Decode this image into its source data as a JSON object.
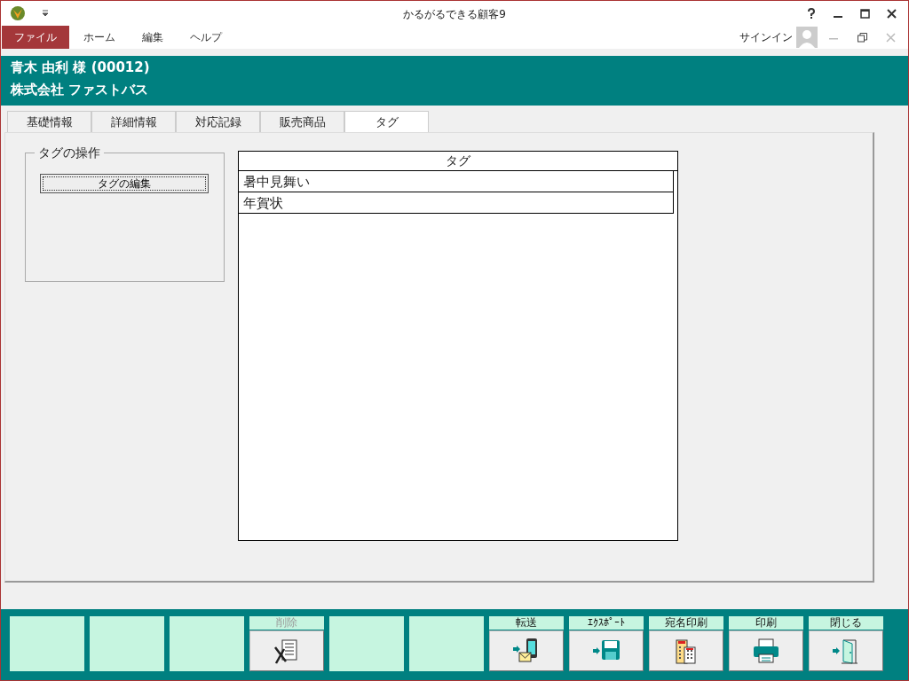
{
  "window": {
    "title": "かるがるできる顧客9"
  },
  "menu": [
    {
      "label": "ファイル",
      "selected": true
    },
    {
      "label": "ホーム",
      "selected": false
    },
    {
      "label": "編集",
      "selected": false
    },
    {
      "label": "ヘルプ",
      "selected": false
    }
  ],
  "account": {
    "label": "サインイン"
  },
  "customer": {
    "name": "青木  由利 様 (00012)",
    "company": "株式会社  ファストバス"
  },
  "tabs": [
    {
      "label": "基礎情報",
      "selected": false
    },
    {
      "label": "詳細情報",
      "selected": false
    },
    {
      "label": "対応記録",
      "selected": false
    },
    {
      "label": "販売商品",
      "selected": false
    },
    {
      "label": "タグ",
      "selected": true
    }
  ],
  "tag_group": {
    "title": "タグの操作",
    "button": "タグの編集"
  },
  "tag_table": {
    "column": "タグ",
    "rows": [
      "暑中見舞い",
      "年賀状"
    ]
  },
  "footer_buttons": [
    {
      "kind": "empty"
    },
    {
      "kind": "empty"
    },
    {
      "kind": "empty"
    },
    {
      "kind": "action",
      "label": "削除",
      "disabled": true
    },
    {
      "kind": "empty"
    },
    {
      "kind": "empty"
    },
    {
      "kind": "action",
      "label": "転送",
      "disabled": false
    },
    {
      "kind": "action",
      "label": "ｴｸｽﾎﾟｰﾄ",
      "disabled": false
    },
    {
      "kind": "action",
      "label": "宛名印刷",
      "disabled": false
    },
    {
      "kind": "action",
      "label": "印刷",
      "disabled": false
    },
    {
      "kind": "action",
      "label": "閉じる",
      "disabled": false
    }
  ]
}
